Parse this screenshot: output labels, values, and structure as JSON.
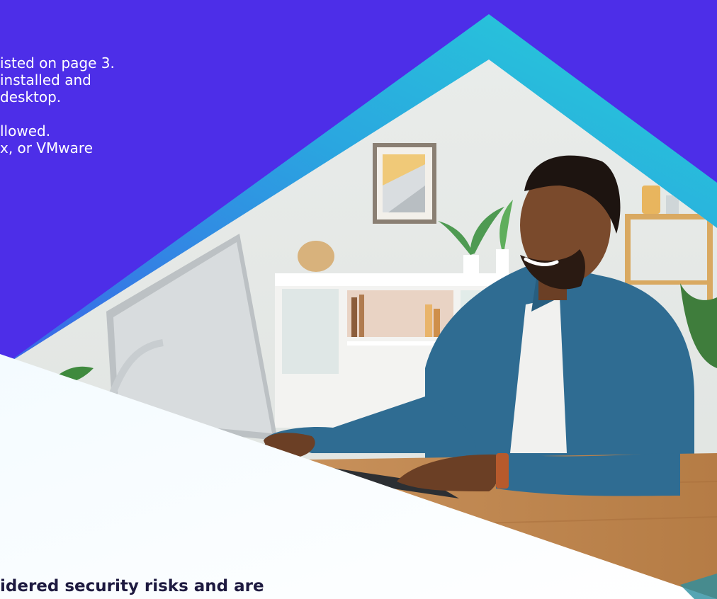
{
  "colors": {
    "background": "#4d2ee8",
    "accent_teal": "#26c6da",
    "panel_white": "#ffffff",
    "heading_text": "#1e1a40",
    "body_text": "#ffffff"
  },
  "body_text": {
    "lines": [
      "isted on page 3.",
      "installed and",
      "desktop.",
      "",
      "llowed.",
      "x, or VMware"
    ]
  },
  "photo": {
    "subject": "man smiling while working at a desktop computer in a bright living room"
  },
  "bottom": {
    "heading": "idered security risks and are"
  }
}
